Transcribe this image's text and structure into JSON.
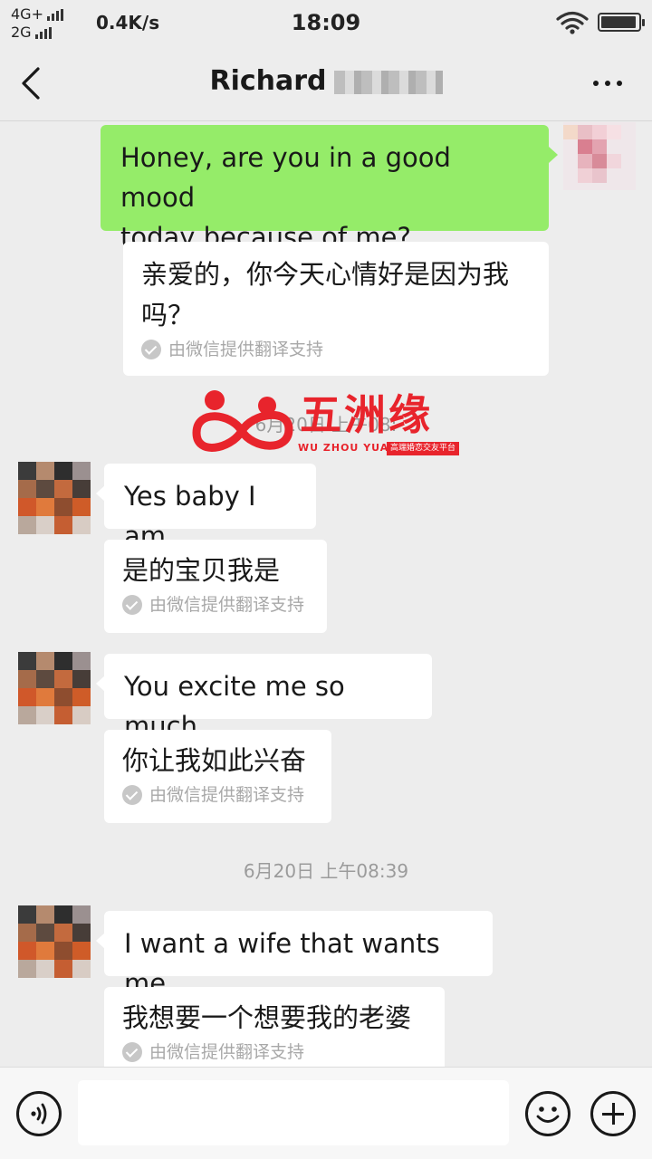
{
  "status_bar": {
    "network_top": "4G+",
    "network_bottom": "2G",
    "speed": "0.4K/s",
    "time": "18:09",
    "wifi_icon": "wifi-icon",
    "battery_level": 0.95
  },
  "header": {
    "title": "Richard",
    "back_icon": "chevron-left-icon",
    "more_icon": "more-dots-icon"
  },
  "messages": [
    {
      "sender": "me",
      "text_lines": [
        "Honey, are you in a good mood",
        "today because of me?"
      ],
      "translation_lines": [
        "亲爱的，你今天心情好是因为我",
        "吗？"
      ],
      "translation_credit": "由微信提供翻译支持"
    },
    {
      "type": "time",
      "text": "6月20日 上午08:"
    },
    {
      "sender": "contact",
      "text": "Yes baby I am",
      "translation": "是的宝贝我是",
      "translation_credit": "由微信提供翻译支持"
    },
    {
      "sender": "contact",
      "text": "You excite me so much",
      "translation": "你让我如此兴奋",
      "translation_credit": "由微信提供翻译支持"
    },
    {
      "type": "time",
      "text": "6月20日 上午08:39"
    },
    {
      "sender": "contact",
      "text": "I want a wife that wants me",
      "translation": "我想要一个想要我的老婆",
      "translation_credit": "由微信提供翻译支持"
    }
  ],
  "watermark": {
    "title": "五洲缘",
    "subtitle": "WU ZHOU YUAN",
    "tag": "高端婚恋交友平台",
    "color": "#e8242c"
  },
  "input_bar": {
    "voice_icon": "voice-icon",
    "emoji_icon": "emoji-icon",
    "plus_icon": "plus-icon",
    "placeholder": ""
  },
  "colors": {
    "background": "#ededed",
    "sent_bubble": "#95ec69",
    "received_bubble": "#ffffff"
  }
}
